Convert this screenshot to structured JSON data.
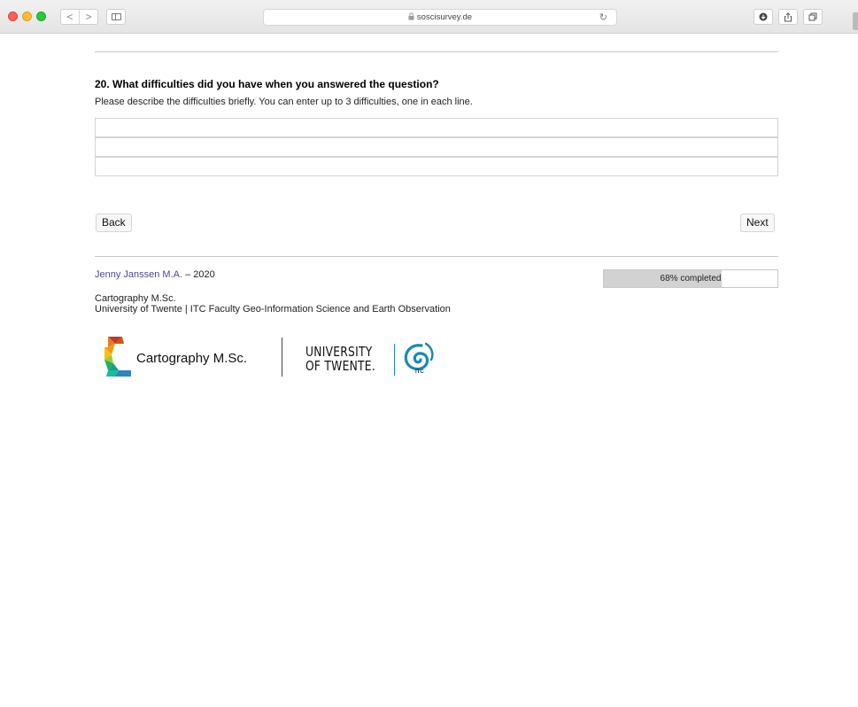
{
  "browser": {
    "url": "soscisurvey.de",
    "nav_back_glyph": "<",
    "nav_forward_glyph": ">",
    "lock_glyph": "🔒",
    "reload_glyph": "↻",
    "icons": [
      "back-icon",
      "forward-icon",
      "sidebar-icon",
      "lock-icon",
      "reload-icon",
      "download-icon",
      "share-icon",
      "tabs-icon"
    ]
  },
  "question": {
    "title": "20. What difficulties did you have when you answered the question?",
    "description": "Please describe the difficulties briefly. You can enter up to 3 difficulties, one in each line.",
    "answers": [
      "",
      "",
      ""
    ]
  },
  "navigation": {
    "back_label": "Back",
    "next_label": "Next"
  },
  "footer": {
    "author_name": "Jenny Janssen M.A.",
    "author_suffix": " – 2020",
    "program_line1": "Cartography M.Sc.",
    "program_line2": "University of Twente | ITC Faculty Geo-Information Science and Earth Observation",
    "progress_percent": 68,
    "progress_text": "68% completed",
    "logo_cartography_text": "Cartography M.Sc.",
    "logo_ut_line1": "UNIVERSITY",
    "logo_ut_line2": "OF TWENTE.",
    "logo_itc_text": "ITC"
  },
  "colors": {
    "author_link": "#4a4a9a",
    "progress_fill": "#d2d2d2",
    "itc_blue": "#1a8ab0"
  }
}
